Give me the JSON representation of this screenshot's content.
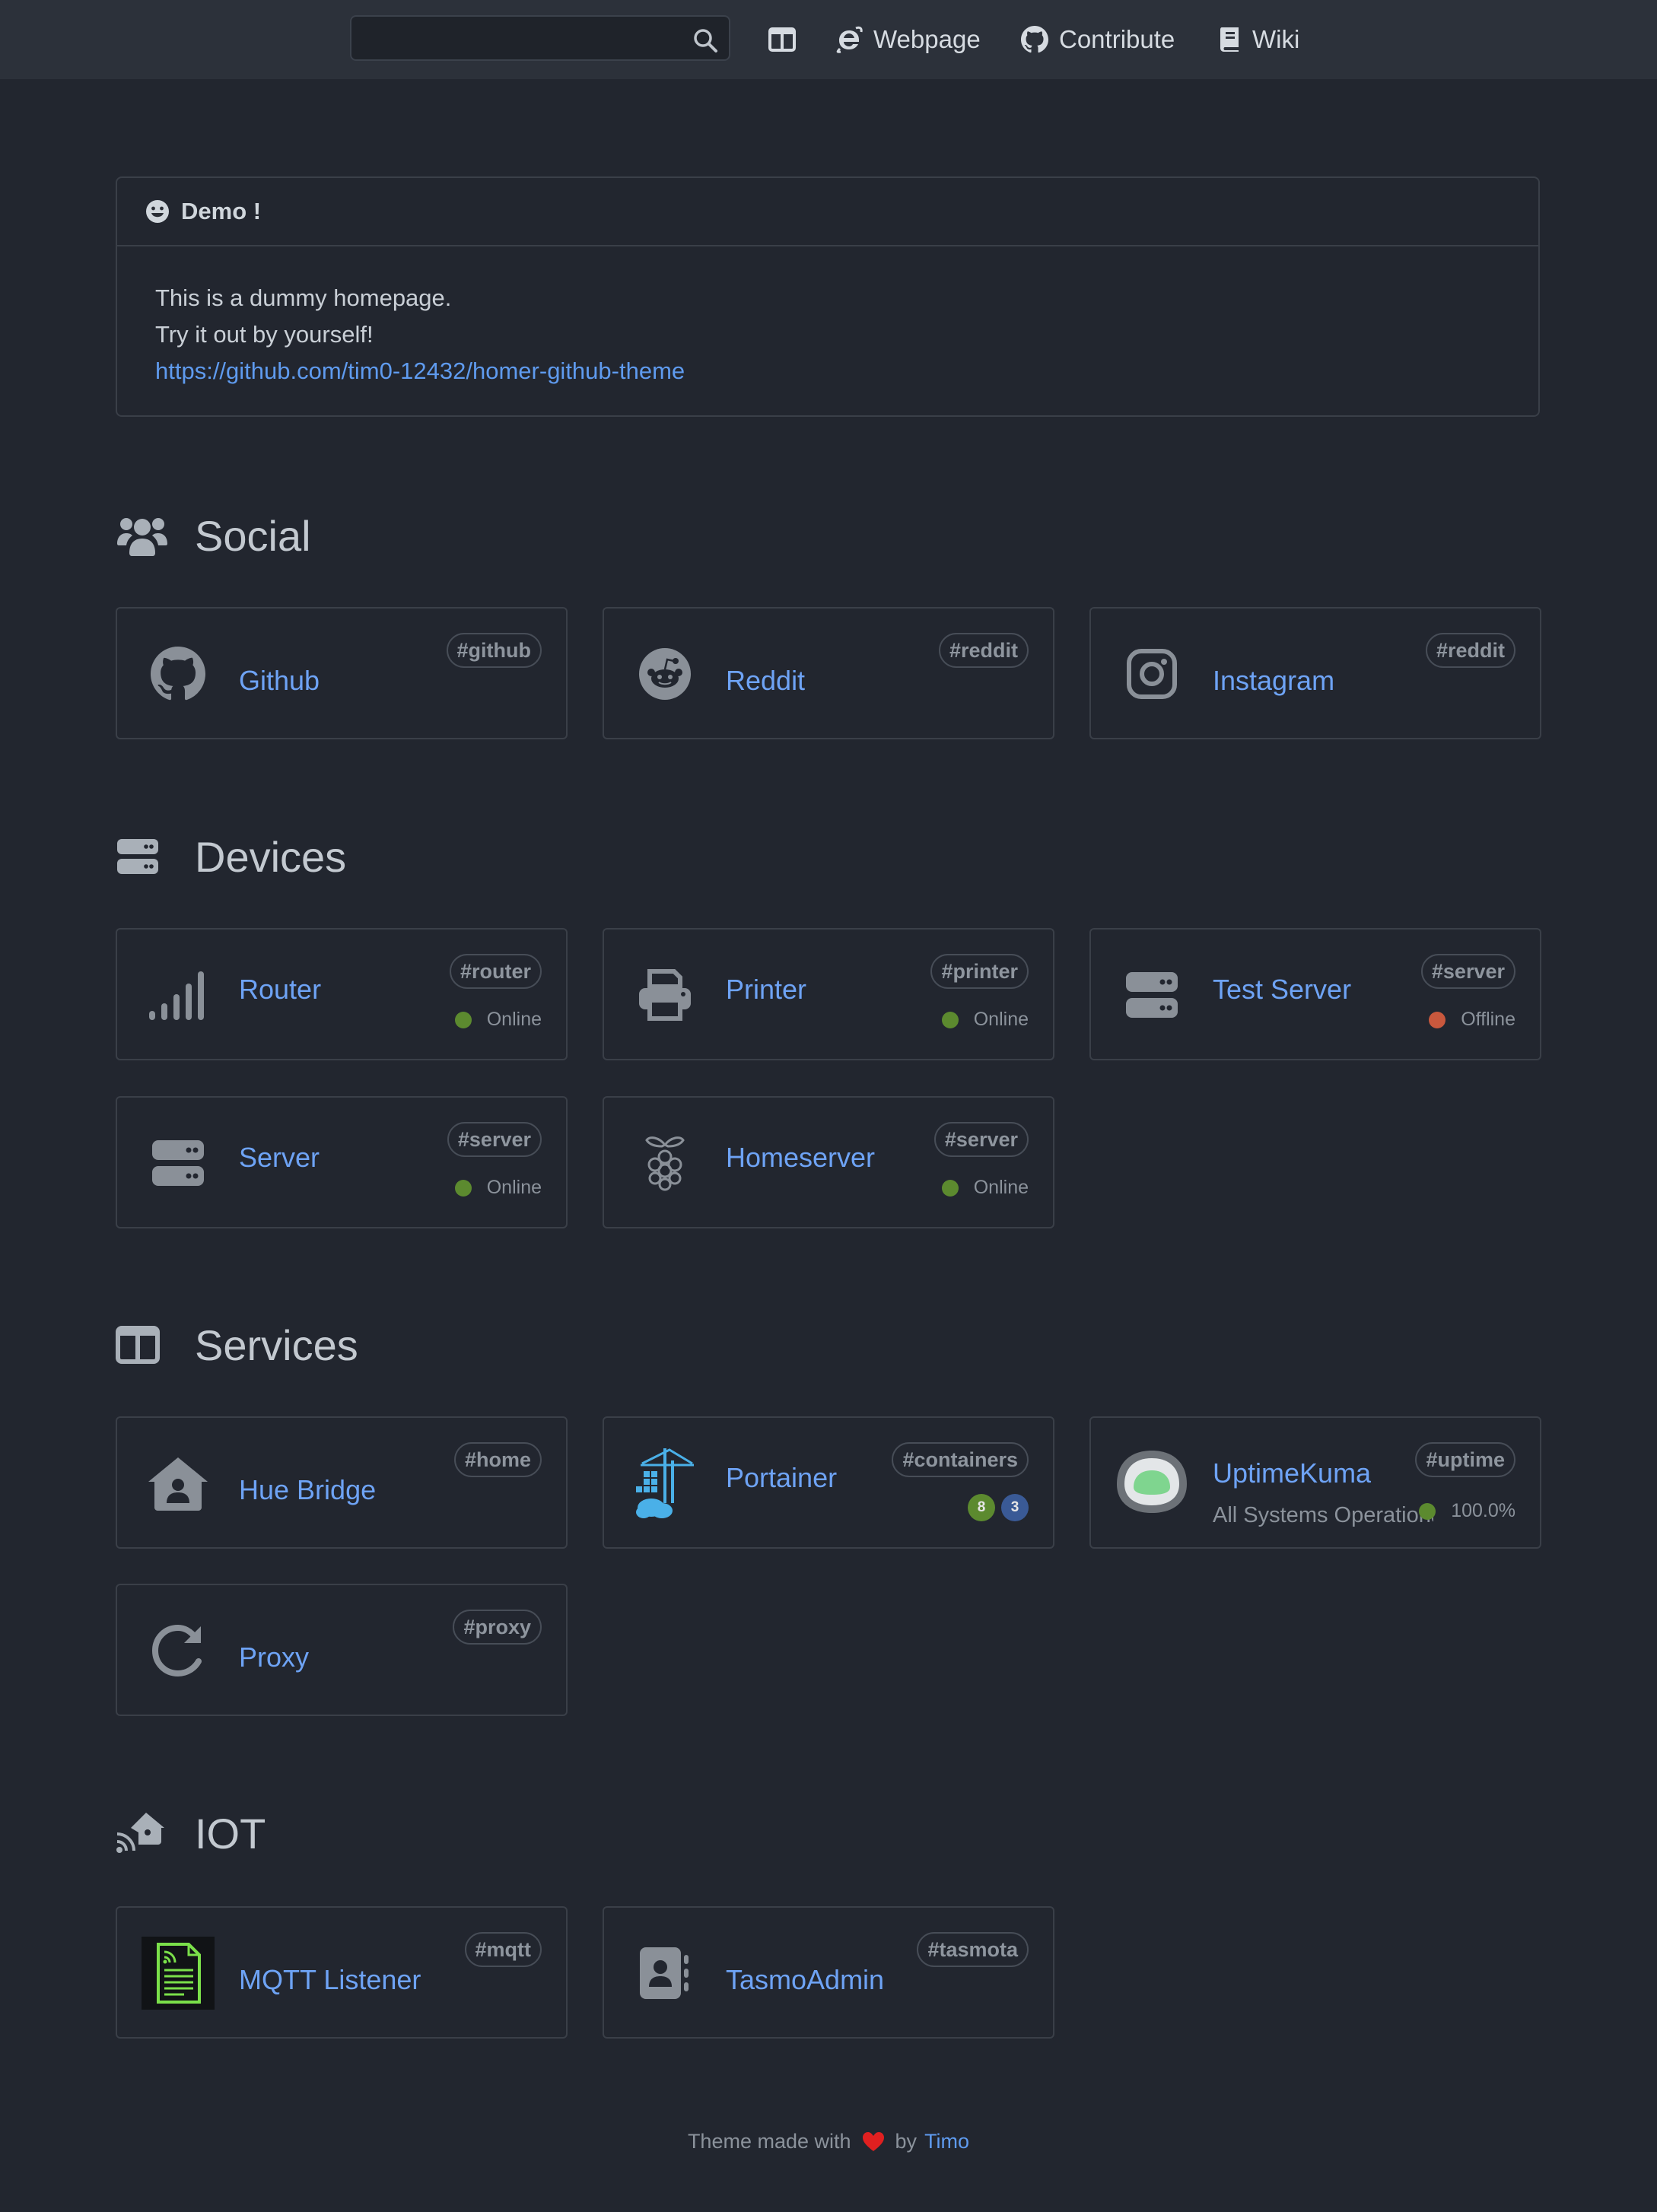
{
  "navbar": {
    "search": {
      "value": "",
      "placeholder": ""
    },
    "links": [
      {
        "label": "",
        "icon": "columns-icon"
      },
      {
        "label": "Webpage",
        "icon": "internet-explorer-icon"
      },
      {
        "label": "Contribute",
        "icon": "github-icon"
      },
      {
        "label": "Wiki",
        "icon": "book-icon"
      }
    ]
  },
  "message": {
    "title": "Demo !",
    "lines": [
      "This is a dummy homepage.",
      "Try it out by yourself!"
    ],
    "link": "https://github.com/tim0-12432/homer-github-theme"
  },
  "groups": [
    {
      "name": "Social",
      "icon": "users-icon",
      "items": [
        {
          "name": "Github",
          "tag": "#github",
          "icon": "github-icon"
        },
        {
          "name": "Reddit",
          "tag": "#reddit",
          "icon": "reddit-icon"
        },
        {
          "name": "Instagram",
          "tag": "#reddit",
          "icon": "instagram-icon"
        }
      ]
    },
    {
      "name": "Devices",
      "icon": "server-icon",
      "items": [
        {
          "name": "Router",
          "tag": "#router",
          "status": "Online",
          "icon": "signal-icon"
        },
        {
          "name": "Printer",
          "tag": "#printer",
          "status": "Online",
          "icon": "printer-icon"
        },
        {
          "name": "Test Server",
          "tag": "#server",
          "status": "Offline",
          "icon": "server-icon"
        },
        {
          "name": "Server",
          "tag": "#server",
          "status": "Online",
          "icon": "server-icon"
        },
        {
          "name": "Homeserver",
          "tag": "#server",
          "status": "Online",
          "icon": "raspberry-pi-icon"
        }
      ]
    },
    {
      "name": "Services",
      "icon": "columns-icon",
      "items": [
        {
          "name": "Hue Bridge",
          "tag": "#home",
          "icon": "house-user-icon"
        },
        {
          "name": "Portainer",
          "tag": "#containers",
          "running": "8",
          "stopped": "3",
          "icon": "portainer-icon"
        },
        {
          "name": "UptimeKuma",
          "tag": "#uptime",
          "subtitle": "All Systems Operational",
          "uptime": "100.0%",
          "icon": "uptime-kuma-icon"
        },
        {
          "name": "Proxy",
          "tag": "#proxy",
          "icon": "redo-icon"
        }
      ]
    },
    {
      "name": "IOT",
      "icon": "house-signal-icon",
      "items": [
        {
          "name": "MQTT Listener",
          "tag": "#mqtt",
          "icon": "mqtt-file-icon"
        },
        {
          "name": "TasmoAdmin",
          "tag": "#tasmota",
          "icon": "address-book-icon"
        }
      ]
    }
  ],
  "footer": {
    "text": "Theme made with",
    "by": "by",
    "author": "Timo"
  },
  "colors": {
    "background": "#22262f",
    "navbar": "#2c313a",
    "link": "#6ea3f5",
    "online": "#5c8a2f",
    "offline": "#c9583d",
    "heart": "#e02020"
  }
}
